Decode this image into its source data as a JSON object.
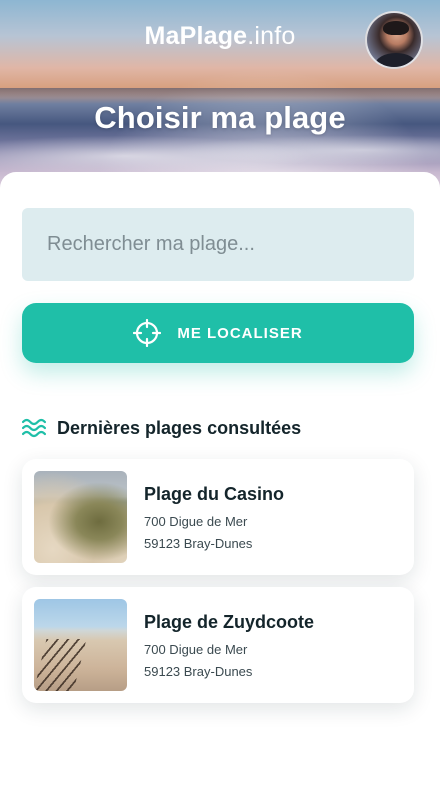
{
  "header": {
    "logo_bold": "MaPlage",
    "logo_light": ".info",
    "title": "Choisir ma plage"
  },
  "search": {
    "placeholder": "Rechercher ma plage..."
  },
  "locate_button": {
    "label": "ME LOCALISER",
    "icon": "crosshair-icon"
  },
  "recent": {
    "title": "Dernières plages consultées",
    "icon": "waves-icon",
    "items": [
      {
        "name": "Plage du Casino",
        "address_line1": "700 Digue de Mer",
        "address_line2": "59123 Bray-Dunes"
      },
      {
        "name": "Plage de Zuydcoote",
        "address_line1": "700 Digue de Mer",
        "address_line2": "59123 Bray-Dunes"
      }
    ]
  },
  "colors": {
    "accent": "#1fbfa8",
    "search_bg": "#ddecef",
    "text_dark": "#14252b"
  }
}
